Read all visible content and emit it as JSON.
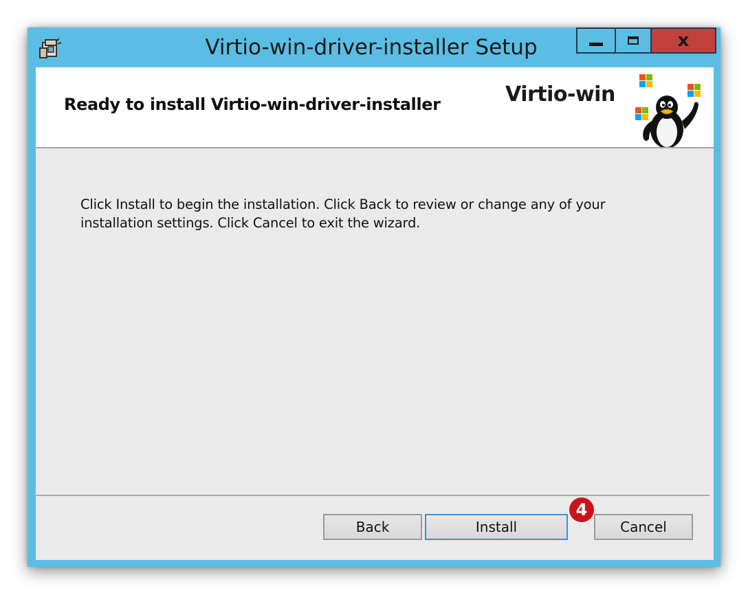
{
  "window": {
    "title": "Virtio-win-driver-installer Setup",
    "icon": "installer-package-icon",
    "controls": {
      "minimize": "minimize-icon",
      "maximize": "maximize-icon",
      "close": "close-icon"
    }
  },
  "banner": {
    "title": "Ready to install Virtio-win-driver-installer",
    "brand": "Virtio-win",
    "art": "tux-penguin-with-windows-logos"
  },
  "body": {
    "line1": "Click Install to begin the installation. Click Back to review or change any of your",
    "line2": "installation settings. Click Cancel to exit the wizard."
  },
  "buttons": {
    "back": "Back",
    "install": "Install",
    "cancel": "Cancel"
  },
  "annotation": {
    "step": "4"
  },
  "colors": {
    "titlebar": "#5bbde3",
    "close_button": "#c1413d",
    "client_background": "#eaeaea",
    "focus_border": "#3b8fd9",
    "step_badge": "#c8141b"
  }
}
